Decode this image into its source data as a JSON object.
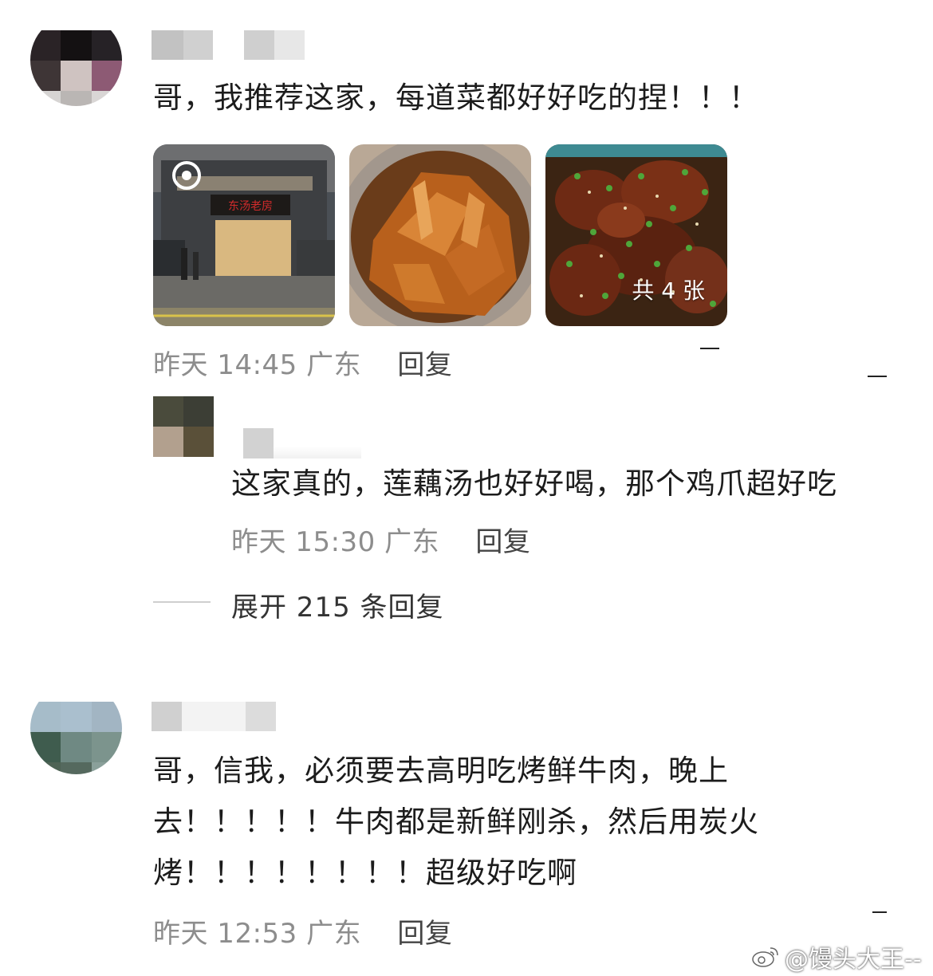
{
  "comments": [
    {
      "text": "哥，我推荐这家，每道菜都好好吃的捏！！！",
      "images": [
        {
          "desc": "restaurant-storefront",
          "sign": "东汤老房"
        },
        {
          "desc": "roast-goose"
        },
        {
          "desc": "braised-pork-knuckle",
          "badge": "共 4 张"
        }
      ],
      "time": "昨天 14:45",
      "location": "广东",
      "reply_label": "回复"
    },
    {
      "text_line1": "哥，信我，必须要去高明吃烤鲜牛肉，晚上",
      "text_line2": "去！！！！！牛肉都是新鲜刚杀，然后用炭火",
      "text_line3": "烤！！！！！！！！超级好吃啊",
      "time": "昨天 12:53",
      "location": "广东",
      "reply_label": "回复"
    }
  ],
  "reply": {
    "text": "这家真的，莲藕汤也好好喝，那个鸡爪超好吃",
    "time": "昨天 15:30",
    "location": "广东",
    "reply_label": "回复"
  },
  "expand_replies": "展开 215 条回复",
  "watermark": "@馒头大王--",
  "icons": {
    "watermark_logo": "weibo-icon"
  }
}
